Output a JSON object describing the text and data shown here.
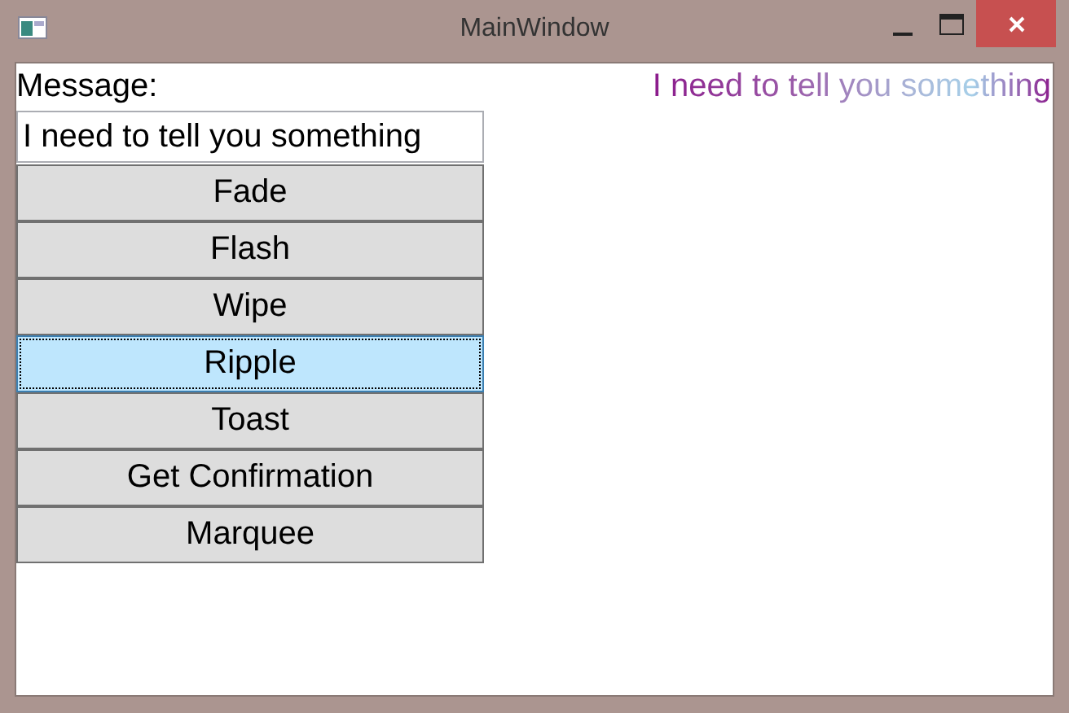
{
  "window": {
    "title": "MainWindow"
  },
  "message_label": "Message:",
  "message_field": {
    "value": "I need to tell you something"
  },
  "animated_text": "I need to tell you something",
  "buttons": [
    {
      "label": "Fade",
      "focused": false
    },
    {
      "label": "Flash",
      "focused": false
    },
    {
      "label": "Wipe",
      "focused": false
    },
    {
      "label": "Ripple",
      "focused": true
    },
    {
      "label": "Toast",
      "focused": false
    },
    {
      "label": "Get Confirmation",
      "focused": false
    },
    {
      "label": "Marquee",
      "focused": false
    }
  ]
}
